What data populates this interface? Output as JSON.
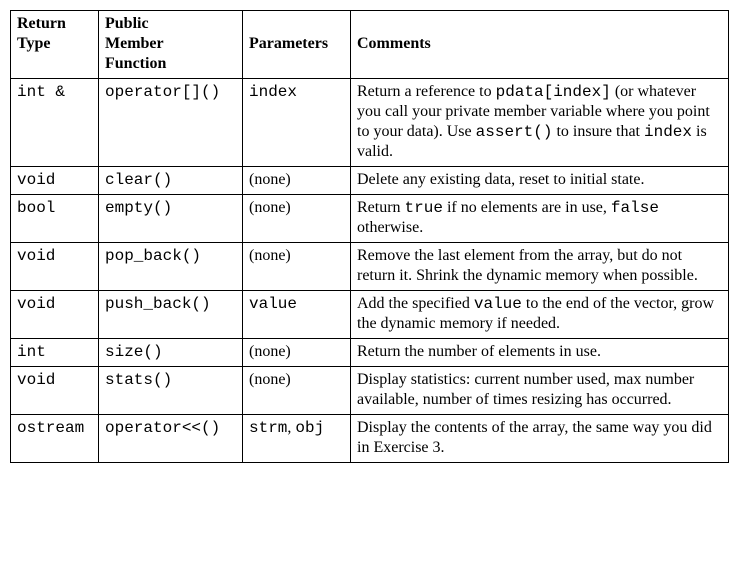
{
  "chart_data": {
    "type": "table",
    "title": "",
    "columns": [
      "Return Type",
      "Public Member Function",
      "Parameters",
      "Comments"
    ],
    "rows": [
      {
        "return_type": "int &",
        "member_function": "operator[]()",
        "parameters": "index",
        "comments": "Return a reference to pdata[index] (or whatever you call your private member variable where you point to your data).  Use assert() to insure that index is valid."
      },
      {
        "return_type": "void",
        "member_function": "clear()",
        "parameters": "(none)",
        "comments": "Delete any existing data, reset to initial state."
      },
      {
        "return_type": "bool",
        "member_function": "empty()",
        "parameters": "(none)",
        "comments": "Return true if no elements are in use, false otherwise."
      },
      {
        "return_type": "void",
        "member_function": "pop_back()",
        "parameters": "(none)",
        "comments": "Remove the last element from the array, but do not return it.  Shrink the dynamic memory when possible."
      },
      {
        "return_type": "void",
        "member_function": "push_back()",
        "parameters": "value",
        "comments": "Add the specified value to the end of the vector, grow the dynamic memory if needed."
      },
      {
        "return_type": "int",
        "member_function": "size()",
        "parameters": "(none)",
        "comments": "Return the number of elements in use."
      },
      {
        "return_type": "void",
        "member_function": "stats()",
        "parameters": "(none)",
        "comments": "Display statistics: current number used, max number available, number of times resizing has occurred."
      },
      {
        "return_type": "ostream",
        "member_function": "operator<<()",
        "parameters": "strm, obj",
        "comments": "Display the contents of the array, the same way you did in Exercise 3."
      }
    ]
  },
  "headers": {
    "h1a": "Return",
    "h1b": "Type",
    "h2a": "Public",
    "h2b": "Member",
    "h2c": "Function",
    "h3": "Parameters",
    "h4": "Comments"
  },
  "rows": [
    {
      "ret": "int &",
      "fn": "operator[]()",
      "params": "index",
      "c": {
        "t1": "Return a reference to ",
        "m1": "pdata[index]",
        "t2": " (or whatever you call your private member variable where you point to your data).  Use ",
        "m2": "assert()",
        "t3": " to insure that ",
        "m3": "index",
        "t4": " is valid."
      }
    },
    {
      "ret": "void",
      "fn": "clear()",
      "params": "(none)",
      "c": {
        "t1": "Delete any existing data, reset to initial state."
      }
    },
    {
      "ret": "bool",
      "fn": "empty()",
      "params": "(none)",
      "c": {
        "t1": "Return ",
        "m1": "true",
        "t2": " if no elements are in use, ",
        "m2": "false",
        "t3": " otherwise."
      }
    },
    {
      "ret": "void",
      "fn": "pop_back()",
      "params": "(none)",
      "c": {
        "t1": "Remove the last element from the array, but do not return it.  Shrink the dynamic memory when possible."
      }
    },
    {
      "ret": "void",
      "fn": "push_back()",
      "params": "value",
      "c": {
        "t1": "Add the specified ",
        "m1": "value",
        "t2": " to the end of the vector, grow the dynamic memory if needed."
      }
    },
    {
      "ret": "int",
      "fn": "size()",
      "params": "(none)",
      "c": {
        "t1": "Return the number of elements in use."
      }
    },
    {
      "ret": "void",
      "fn": "stats()",
      "params": "(none)",
      "c": {
        "t1": "Display statistics: current number used, max number available, number of times resizing has occurred."
      }
    },
    {
      "ret": "ostream",
      "fn": "operator<<()",
      "params": "strm",
      "params_sep": ", ",
      "params2": "obj",
      "c": {
        "t1": "Display the contents of the array, the same way you did in Exercise 3."
      }
    }
  ]
}
